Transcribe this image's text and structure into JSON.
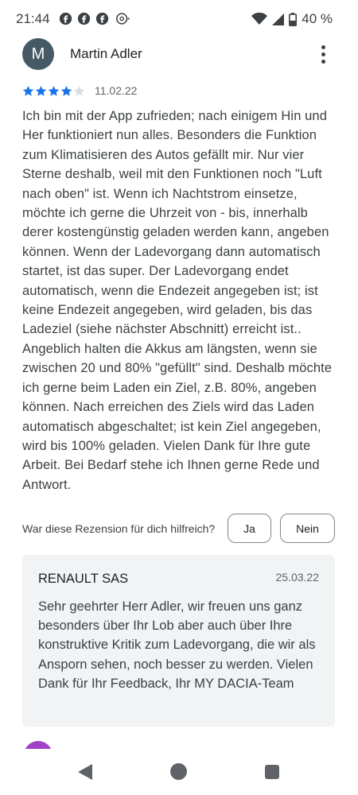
{
  "status_bar": {
    "time": "21:44",
    "battery": "40 %",
    "icons": [
      "facebook-icon",
      "facebook-icon",
      "facebook-icon",
      "threads-icon",
      "dot-icon",
      "wifi-icon",
      "signal-icon",
      "battery-icon"
    ]
  },
  "review": {
    "avatar_letter": "M",
    "reviewer_name": "Martin Adler",
    "rating": 4,
    "max_rating": 5,
    "date": "11.02.22",
    "text": "Ich bin mit der App zufrieden; nach einigem Hin und Her funktioniert nun alles. Besonders die Funktion zum Klimatisieren des Autos gefällt mir. Nur vier Sterne deshalb, weil mit den Funktionen noch \"Luft nach oben\" ist. Wenn ich Nachtstrom einsetze, möchte ich gerne die Uhrzeit von - bis, innerhalb derer kostengünstig geladen werden kann, angeben können. Wenn der Ladevorgang dann automatisch startet, ist das super. Der Ladevorgang endet automatisch, wenn die Endezeit angegeben ist; ist keine Endezeit angegeben, wird geladen, bis das Ladeziel (siehe nächster Abschnitt) erreicht ist.. Angeblich halten die Akkus am längsten, wenn sie zwischen 20 und 80% \"gefüllt\" sind. Deshalb möchte ich gerne beim Laden ein Ziel, z.B. 80%, angeben können. Nach erreichen des Ziels wird das Laden automatisch abgeschaltet; ist kein Ziel angegeben, wird bis 100% geladen. Vielen Dank für Ihre gute Arbeit. Bei Bedarf stehe ich Ihnen gerne Rede und Antwort."
  },
  "helpful": {
    "question": "War diese Rezension für dich hilfreich?",
    "yes_label": "Ja",
    "no_label": "Nein"
  },
  "reply": {
    "author": "RENAULT SAS",
    "date": "25.03.22",
    "text": "Sehr geehrter Herr Adler, wir freuen uns ganz besonders über Ihr Lob aber auch über Ihre konstruktive Kritik zum Ladevorgang, die wir als Ansporn sehen, noch besser zu werden. Vielen Dank für Ihr Feedback, Ihr MY DACIA-Team"
  },
  "colors": {
    "star_filled": "#1a73e8",
    "star_empty": "#dadce0",
    "avatar_bg": "#455a64",
    "next_avatar": "#a142c9"
  }
}
